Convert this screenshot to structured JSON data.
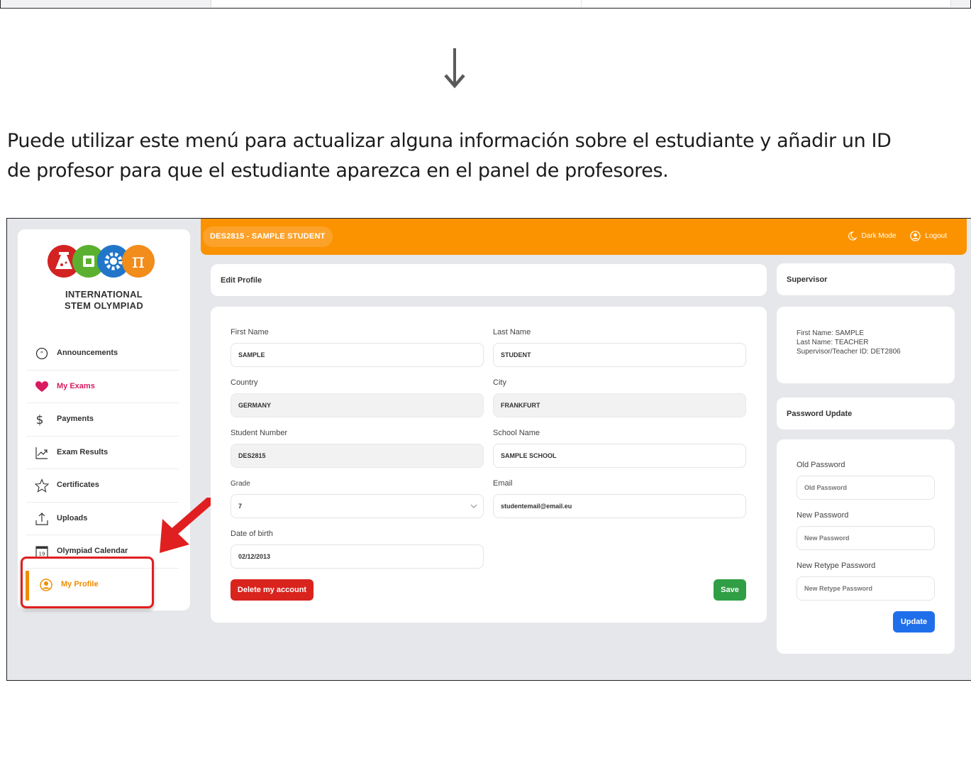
{
  "instruction": {
    "line1": "Puede utilizar este menú para actualizar alguna información sobre el estudiante y añadir un ID",
    "line2": "de profesor para que el estudiante aparezca en el panel de profesores."
  },
  "colors": {
    "accent": "#fb9300",
    "highlight": "#e02020",
    "delete": "#d9231d",
    "save": "#2f9e44",
    "update": "#1f6feb"
  },
  "brand": {
    "line1": "INTERNATIONAL",
    "line2": "STEM OLYMPIAD"
  },
  "sidebar": {
    "items": [
      {
        "label": "Announcements",
        "icon": "speech-bubble-icon"
      },
      {
        "label": "My Exams",
        "icon": "heart-icon"
      },
      {
        "label": "Payments",
        "icon": "dollar-icon"
      },
      {
        "label": "Exam Results",
        "icon": "line-chart-icon"
      },
      {
        "label": "Certificates",
        "icon": "star-icon"
      },
      {
        "label": "Uploads",
        "icon": "upload-icon"
      },
      {
        "label": "Olympiad Calendar",
        "icon": "calendar-icon"
      },
      {
        "label": "My Profile",
        "icon": "user-circle-icon"
      }
    ],
    "calendar_day": "19"
  },
  "topbar": {
    "user": "DES2815 - SAMPLE STUDENT",
    "dark_mode": "Dark Mode",
    "logout": "Logout"
  },
  "edit_profile": {
    "title": "Edit Profile",
    "first_name_label": "First Name",
    "first_name": "SAMPLE",
    "last_name_label": "Last Name",
    "last_name": "STUDENT",
    "country_label": "Country",
    "country": "GERMANY",
    "city_label": "City",
    "city": "FRANKFURT",
    "student_number_label": "Student Number",
    "student_number": "DES2815",
    "school_name_label": "School Name",
    "school_name": "SAMPLE SCHOOL",
    "grade_label": "Grade",
    "grade": "7",
    "email_label": "Email",
    "email": "studentemail@email.eu",
    "dob_label": "Date of birth",
    "dob": "02/12/2013",
    "delete_label": "Delete my account",
    "save_label": "Save"
  },
  "supervisor": {
    "title": "Supervisor",
    "first_name": "First Name: SAMPLE",
    "last_name": "Last Name: TEACHER",
    "teacher_id": "Supervisor/Teacher ID: DET2806"
  },
  "password": {
    "title": "Password Update",
    "old_label": "Old Password",
    "old_placeholder": "Old Password",
    "new_label": "New Password",
    "new_placeholder": "New Password",
    "retype_label": "New Retype Password",
    "retype_placeholder": "New Retype Password",
    "update_label": "Update"
  }
}
